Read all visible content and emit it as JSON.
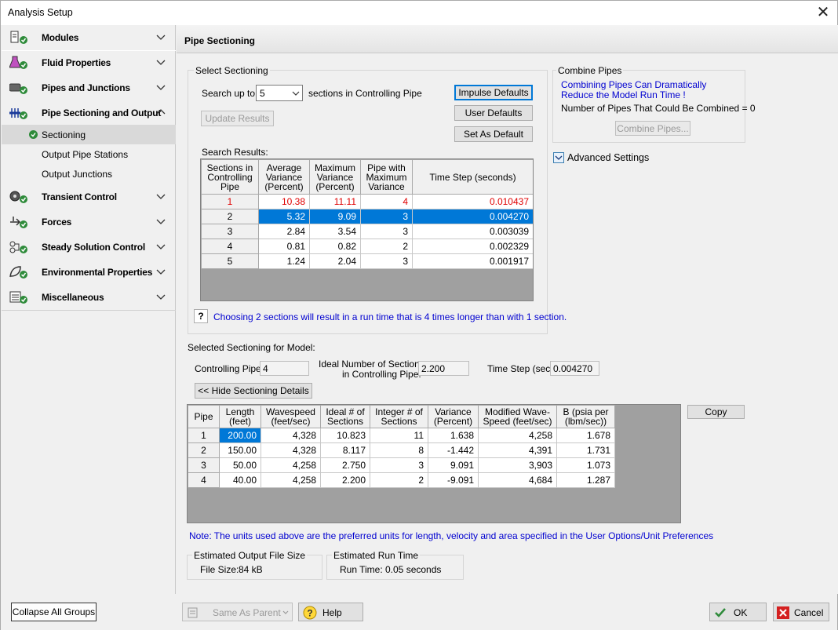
{
  "window": {
    "title": "Analysis Setup",
    "close": "✕"
  },
  "sidebar": {
    "groups": [
      {
        "label": "Modules"
      },
      {
        "label": "Fluid Properties"
      },
      {
        "label": "Pipes and Junctions"
      },
      {
        "label": "Pipe Sectioning and Output"
      },
      {
        "label": "Transient Control"
      },
      {
        "label": "Forces"
      },
      {
        "label": "Steady Solution Control"
      },
      {
        "label": "Environmental Properties"
      },
      {
        "label": "Miscellaneous"
      }
    ],
    "subitems": [
      {
        "label": "Sectioning"
      },
      {
        "label": "Output Pipe Stations"
      },
      {
        "label": "Output Junctions"
      }
    ]
  },
  "panel": {
    "title": "Pipe Sectioning"
  },
  "select_sectioning": {
    "legend": "Select Sectioning",
    "search_label": "Search up to:",
    "search_value": "5",
    "search_suffix": "sections in Controlling Pipe",
    "update_results": "Update Results",
    "impulse_defaults": "Impulse Defaults",
    "user_defaults": "User Defaults",
    "set_as_default": "Set As Default",
    "results_label": "Search Results:",
    "headers": [
      "Sections in Controlling Pipe",
      "Average Variance (Percent)",
      "Maximum Variance (Percent)",
      "Pipe with Maximum Variance",
      "Time Step (seconds)"
    ],
    "rows": [
      [
        "1",
        "10.38",
        "11.11",
        "4",
        "0.010437"
      ],
      [
        "2",
        "5.32",
        "9.09",
        "3",
        "0.004270"
      ],
      [
        "3",
        "2.84",
        "3.54",
        "3",
        "0.003039"
      ],
      [
        "4",
        "0.81",
        "0.82",
        "2",
        "0.002329"
      ],
      [
        "5",
        "1.24",
        "2.04",
        "3",
        "0.001917"
      ]
    ],
    "help_glyph": "?",
    "note": "Choosing 2 sections will result in a run time that is 4 times longer than with 1 section."
  },
  "combine": {
    "legend": "Combine Pipes",
    "warning": "Combining Pipes Can Dramatically Reduce the Model Run Time !",
    "count_text": "Number of Pipes That Could Be Combined = 0",
    "button": "Combine Pipes..."
  },
  "advanced": {
    "label": "Advanced Settings"
  },
  "model": {
    "title": "Selected Sectioning for Model:",
    "controlling_pipe_label": "Controlling Pipe:",
    "controlling_pipe_value": "4",
    "ideal_label_1": "Ideal Number of Sections",
    "ideal_label_2": "in Controlling Pipe:",
    "ideal_value": "2.200",
    "timestep_label": "Time Step (sec):",
    "timestep_value": "0.004270",
    "hide_details": "<< Hide Sectioning Details",
    "copy": "Copy",
    "headers": [
      "Pipe",
      "Length (feet)",
      "Wavespeed (feet/sec)",
      "Ideal # of Sections",
      "Integer # of Sections",
      "Variance (Percent)",
      "Modified Wave-Speed (feet/sec)",
      "B (psia per (lbm/sec))"
    ],
    "rows": [
      [
        "1",
        "200.00",
        "4,328",
        "10.823",
        "11",
        "1.638",
        "4,258",
        "1.678"
      ],
      [
        "2",
        "150.00",
        "4,328",
        "8.117",
        "8",
        "-1.442",
        "4,391",
        "1.731"
      ],
      [
        "3",
        "50.00",
        "4,258",
        "2.750",
        "3",
        "9.091",
        "3,903",
        "1.073"
      ],
      [
        "4",
        "40.00",
        "4,258",
        "2.200",
        "2",
        "-9.091",
        "4,684",
        "1.287"
      ]
    ],
    "units_note": "Note: The units used above are the preferred units for length, velocity and area specified in the User Options/Unit Preferences"
  },
  "file_size": {
    "legend": "Estimated Output File Size",
    "label": "File Size:",
    "value": "84 kB"
  },
  "run_time": {
    "legend": "Estimated Run Time",
    "label": "Run Time:",
    "value": "0.05 seconds"
  },
  "bottom": {
    "collapse": "Collapse All Groups",
    "same_as_parent": "Same As Parent",
    "help": "Help",
    "ok": "OK",
    "cancel": "Cancel"
  },
  "colors": {
    "accent": "#0078d7",
    "check_green": "#2e8b3a",
    "warning_red": "#e00000",
    "link_blue": "#0000d0"
  }
}
